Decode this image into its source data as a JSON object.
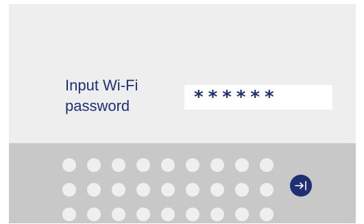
{
  "prompt": {
    "text": "Input Wi-Fi\npassword"
  },
  "password_field": {
    "masked_value": "******"
  },
  "keyboard": {
    "rows": 3,
    "columns": 9,
    "enter_icon": "arrow-right-to-bar-icon"
  },
  "colors": {
    "accent": "#1e2f73",
    "screen_background": "#eeeeee",
    "keyboard_background": "#c8c8c8",
    "key": "#efefef",
    "field_background": "#ffffff"
  }
}
